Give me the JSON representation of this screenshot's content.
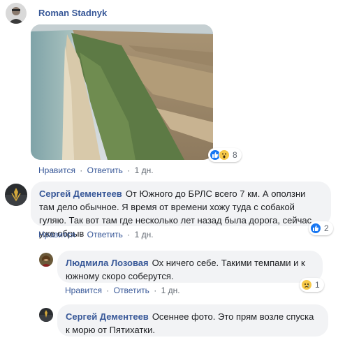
{
  "post": {
    "author": "Roman Stadnyk",
    "reaction_count": "8",
    "actions": {
      "like": "Нравится",
      "reply": "Ответить",
      "time": "1 дн."
    }
  },
  "comments": [
    {
      "author": "Сергей Дементеев",
      "text": "От Южного до БРЛС всего 7 км. А оползни там дело обычное. Я время от времени хожу туда с собакой гуляю. Так вот там где несколько лет назад была дорога, сейчас уже обрыв",
      "reaction_count": "2",
      "actions": {
        "like": "Нравится",
        "reply": "Ответить",
        "time": "1 дн."
      }
    },
    {
      "author": "Людмила Лозовая",
      "text": "Ох ничего себе. Такими темпами и к южному скоро соберутся.",
      "reaction_count": "1",
      "actions": {
        "like": "Нравится",
        "reply": "Ответить",
        "time": "1 дн."
      }
    },
    {
      "author": "Сергей Дементеев",
      "text": "Осеннее фото. Это прям возле спуска к морю от Пятихатки."
    }
  ],
  "separator": "·",
  "colors": {
    "link": "#385898",
    "meta": "#606770",
    "bubble": "#f2f3f5",
    "like_blue": "#1877f2",
    "emoji_yellow": "#f7c948"
  },
  "icons": [
    "like-icon",
    "wow-icon",
    "sad-icon"
  ]
}
